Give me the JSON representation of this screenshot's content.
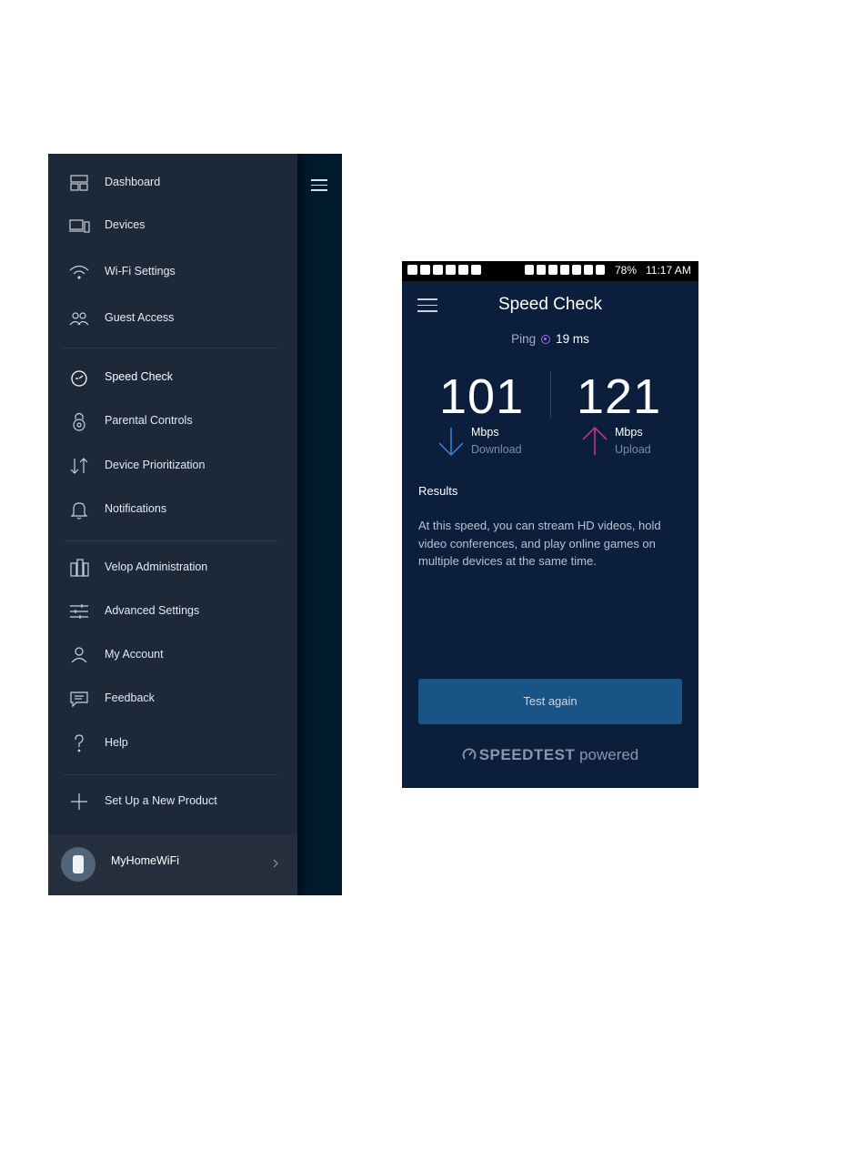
{
  "drawer": {
    "items": [
      {
        "label": "Dashboard",
        "icon": "dashboard-icon"
      },
      {
        "label": "Devices",
        "icon": "devices-icon"
      },
      {
        "label": "Wi-Fi Settings",
        "icon": "wifi-icon"
      },
      {
        "label": "Guest Access",
        "icon": "guest-access-icon"
      },
      {
        "label": "Speed Check",
        "icon": "speed-check-icon",
        "active": true
      },
      {
        "label": "Parental Controls",
        "icon": "lock-icon"
      },
      {
        "label": "Device Prioritization",
        "icon": "priority-arrows-icon"
      },
      {
        "label": "Notifications",
        "icon": "bell-icon"
      },
      {
        "label": "Velop Administration",
        "icon": "velop-nodes-icon"
      },
      {
        "label": "Advanced Settings",
        "icon": "sliders-icon"
      },
      {
        "label": "My Account",
        "icon": "user-icon"
      },
      {
        "label": "Feedback",
        "icon": "chat-bubble-icon"
      },
      {
        "label": "Help",
        "icon": "question-icon"
      },
      {
        "label": "Set Up a New Product",
        "icon": "plus-icon"
      }
    ],
    "network_name": "MyHomeWiFi"
  },
  "phone": {
    "status_bar": {
      "battery": "78%",
      "time": "11:17 AM"
    },
    "title": "Speed Check",
    "ping_label": "Ping",
    "ping_value": "19 ms",
    "download": {
      "value": "101",
      "unit": "Mbps",
      "label": "Download"
    },
    "upload": {
      "value": "121",
      "unit": "Mbps",
      "label": "Upload"
    },
    "results_heading": "Results",
    "results_text": "At this speed, you can stream HD videos, hold video conferences, and play online games on multiple devices at the same time.",
    "test_again_label": "Test again",
    "powered_by": {
      "brand": "SPEEDTEST",
      "suffix": "powered"
    }
  },
  "colors": {
    "drawer_bg": "#1d2838",
    "phone_bg": "#0b1e3b",
    "download_arrow": "#3e86d9",
    "upload_arrow": "#d3339e",
    "ping_accent": "#a070e8",
    "button_bg": "#1a5487"
  }
}
